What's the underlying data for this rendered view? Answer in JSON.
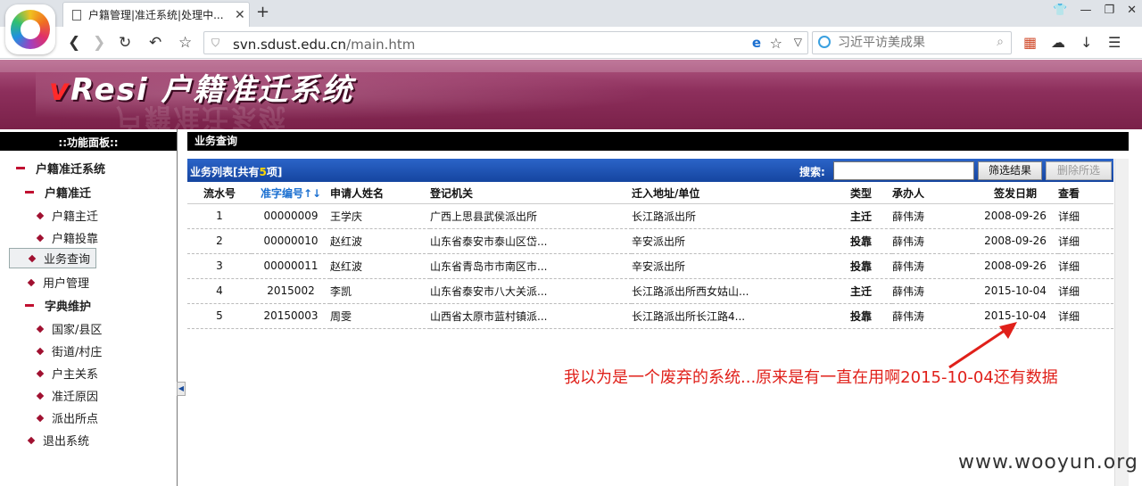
{
  "browser": {
    "tab_title": "户籍管理|准迁系统|处理中...",
    "url_host": "svn.sdust.edu.cn",
    "url_path": "/main.htm",
    "search_placeholder": "习近平访美成果"
  },
  "banner": {
    "brand_v": "v",
    "brand_rest": "Resi",
    "title": "户籍准迁系统"
  },
  "sidebar": {
    "header": "::功能面板::",
    "items": [
      {
        "label": "户籍准迁系统"
      },
      {
        "label": "户籍准迁"
      },
      {
        "label": "户籍主迁"
      },
      {
        "label": "户籍投靠"
      },
      {
        "label": "业务查询"
      },
      {
        "label": "用户管理"
      },
      {
        "label": "字典维护"
      },
      {
        "label": "国家/县区"
      },
      {
        "label": "街道/村庄"
      },
      {
        "label": "户主关系"
      },
      {
        "label": "准迁原因"
      },
      {
        "label": "派出所点"
      },
      {
        "label": "退出系统"
      }
    ]
  },
  "main": {
    "header": "业务查询",
    "list_prefix": "业务列表[共有",
    "list_count": "5",
    "list_suffix": "项]",
    "search_label": "搜索:",
    "filter_button": "筛选结果",
    "delete_button": "删除所选",
    "columns": [
      "流水号",
      "准字编号↑↓",
      "申请人姓名",
      "登记机关",
      "迁入地址/单位",
      "类型",
      "承办人",
      "签发日期",
      "查看"
    ],
    "rows": [
      {
        "no": "1",
        "code": "00000009",
        "name": "王学庆",
        "office": "广西上思县武侯派出所",
        "addr": "长江路派出所",
        "type": "主迁",
        "agent": "薛伟涛",
        "date": "2008-09-26",
        "view": "详细"
      },
      {
        "no": "2",
        "code": "00000010",
        "name": "赵红波",
        "office": "山东省泰安市泰山区岱...",
        "addr": "辛安派出所",
        "type": "投靠",
        "agent": "薛伟涛",
        "date": "2008-09-26",
        "view": "详细"
      },
      {
        "no": "3",
        "code": "00000011",
        "name": "赵红波",
        "office": "山东省青岛市市南区市...",
        "addr": "辛安派出所",
        "type": "投靠",
        "agent": "薛伟涛",
        "date": "2008-09-26",
        "view": "详细"
      },
      {
        "no": "4",
        "code": "2015002",
        "name": "李凯",
        "office": "山东省泰安市八大关派...",
        "addr": "长江路派出所西女姑山...",
        "type": "主迁",
        "agent": "薛伟涛",
        "date": "2015-10-04",
        "view": "详细"
      },
      {
        "no": "5",
        "code": "20150003",
        "name": "周雯",
        "office": "山西省太原市蓝村镇派...",
        "addr": "长江路派出所长江路4...",
        "type": "投靠",
        "agent": "薛伟涛",
        "date": "2015-10-04",
        "view": "详细"
      }
    ]
  },
  "annotation": "我以为是一个废弃的系统...原来是有一直在用啊2015-10-04还有数据",
  "watermark": "www.wooyun.org",
  "colors": {
    "type_main": "#e01010",
    "type_touk": "#1010c0",
    "banner": "#8d2f5c",
    "list_bar": "#1f55b4"
  }
}
